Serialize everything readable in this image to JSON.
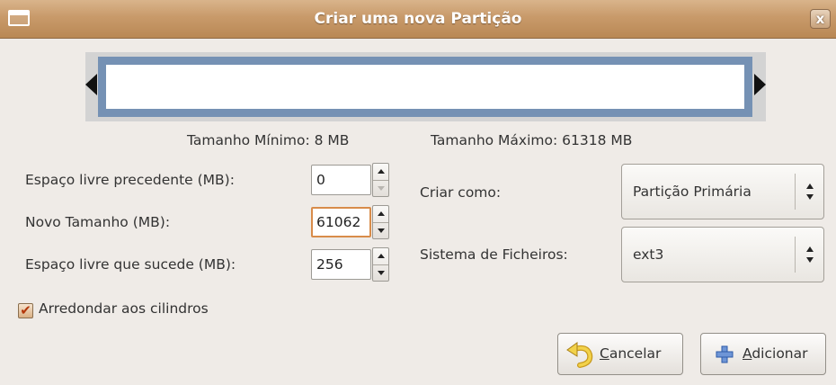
{
  "window": {
    "title": "Criar uma nova Partição",
    "close_glyph": "x"
  },
  "sizes": {
    "min_label": "Tamanho Mínimo: 8 MB",
    "max_label": "Tamanho Máximo: 61318 MB"
  },
  "fields": {
    "preceding_label": "Espaço livre precedente (MB):",
    "preceding_value": "0",
    "new_size_label": "Novo Tamanho (MB):",
    "new_size_value": "61062",
    "following_label": "Espaço livre que sucede (MB):",
    "following_value": "256"
  },
  "create_as": {
    "label": "Criar como:",
    "value": "Partição Primária"
  },
  "filesystem": {
    "label": "Sistema de Ficheiros:",
    "value": "ext3"
  },
  "round_cylinders": {
    "label": "Arredondar aos cilindros",
    "checked": true,
    "check_glyph": "✔"
  },
  "buttons": {
    "cancel_mnemonic": "C",
    "cancel_rest": "ancelar",
    "add_mnemonic": "A",
    "add_rest": "dicionar"
  },
  "colors": {
    "titlebar": "#c89a6a",
    "partition_border": "#7591b4",
    "focus": "#d88c4a",
    "add_icon": "#4a77c4",
    "undo_icon": "#e8c03a"
  },
  "icons": {
    "window_menu": "window-menu-icon",
    "close": "close-icon",
    "cancel": "undo-arrow-icon",
    "add": "plus-icon"
  }
}
